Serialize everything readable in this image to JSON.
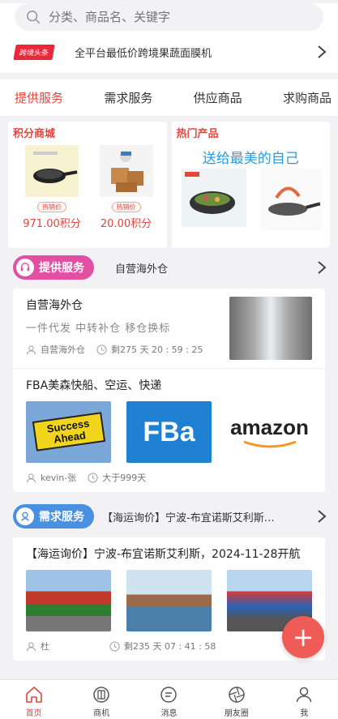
{
  "search": {
    "placeholder": "分类、商品名、关键字"
  },
  "news": {
    "badge": "跨境头条",
    "text": "全平台最低价跨境果蔬面膜机"
  },
  "tabs": [
    "提供服务",
    "需求服务",
    "供应商品",
    "求购商品"
  ],
  "points_mall": {
    "title": "积分商城",
    "items": [
      {
        "tag": "热销价",
        "price": "971.00积分"
      },
      {
        "tag": "热销价",
        "price": "20.00积分"
      }
    ]
  },
  "hot_products": {
    "title": "热门产品",
    "banner": "送给最美的自己"
  },
  "offer_section": {
    "badge": "提供服务",
    "subtitle": "自营海外仓",
    "items": [
      {
        "title": "自营海外仓",
        "tags": "一件代发 中转补仓 移仓换标",
        "user": "自营海外仓",
        "time": "剩275 天 20 : 59 : 25"
      },
      {
        "title": "FBA美森快船、空运、快递",
        "user": "kevin-张",
        "time": "大于999天",
        "thumbs": [
          "Success Ahead",
          "FBa",
          "amazon"
        ]
      }
    ]
  },
  "demand_section": {
    "badge": "需求服务",
    "subtitle": "【海运询价】宁波-布宜诺斯艾利斯…",
    "items": [
      {
        "title": "【海运询价】宁波-布宜诺斯艾利斯，2024-11-28开航",
        "user": "杜",
        "time": "剩235 天 07 : 41 : 58"
      }
    ]
  },
  "fab": {
    "label": "+"
  },
  "nav": [
    {
      "label": "首页",
      "icon": "home-icon"
    },
    {
      "label": "商机",
      "icon": "opportunity-icon"
    },
    {
      "label": "消息",
      "icon": "message-icon"
    },
    {
      "label": "朋友圈",
      "icon": "moments-icon"
    },
    {
      "label": "我",
      "icon": "profile-icon"
    }
  ],
  "colors": {
    "accent": "#e3463b",
    "offer_pill": "#e34fa3",
    "demand_pill": "#4a90e2",
    "banner_blue": "#2a9be0"
  }
}
